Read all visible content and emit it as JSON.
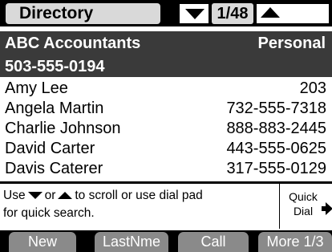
{
  "header": {
    "title": "Directory",
    "page_indicator": "1/48"
  },
  "selected_entry": {
    "name": "ABC Accountants",
    "type": "Personal",
    "number": "503-555-0194"
  },
  "entries": [
    {
      "name": "Amy Lee",
      "number": "203"
    },
    {
      "name": "Angela Martin",
      "number": "732-555-7318"
    },
    {
      "name": "Charlie Johnson",
      "number": "888-883-2445"
    },
    {
      "name": "David Carter",
      "number": "443-555-0625"
    },
    {
      "name": "Davis Caterer",
      "number": "317-555-0129"
    }
  ],
  "help": {
    "part1": "Use",
    "part2": "or",
    "part3": "to scroll or use dial pad",
    "line2": "for quick search."
  },
  "quick_dial": {
    "line1": "Quick",
    "line2": "Dial"
  },
  "softkeys": {
    "new": "New",
    "lastname": "LastNme",
    "call": "Call",
    "more": "More 1/3"
  },
  "icons": {
    "scroll_down": "triangle-down-icon",
    "scroll_up": "triangle-up-icon",
    "quick_dial_arrow": "arrow-right-icon"
  }
}
